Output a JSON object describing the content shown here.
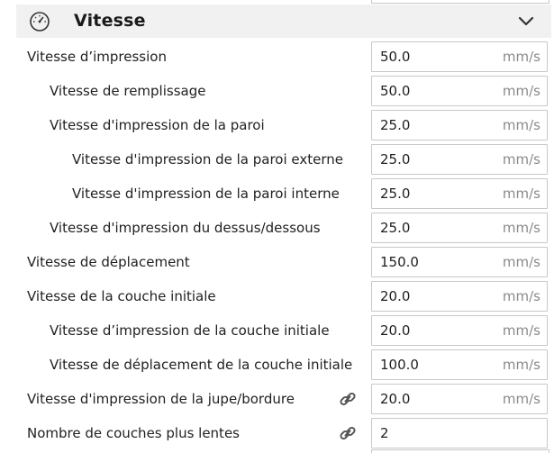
{
  "section": {
    "title": "Vitesse",
    "icon": "speedometer-icon",
    "toggle_icon": "chevron-down-icon"
  },
  "settings": [
    {
      "label": "Vitesse d’impression",
      "value": "50.0",
      "unit": "mm/s",
      "indent": 0,
      "linked": false
    },
    {
      "label": "Vitesse de remplissage",
      "value": "50.0",
      "unit": "mm/s",
      "indent": 1,
      "linked": false
    },
    {
      "label": "Vitesse d'impression de la paroi",
      "value": "25.0",
      "unit": "mm/s",
      "indent": 1,
      "linked": false
    },
    {
      "label": "Vitesse d'impression de la paroi externe",
      "value": "25.0",
      "unit": "mm/s",
      "indent": 2,
      "linked": false
    },
    {
      "label": "Vitesse d'impression de la paroi interne",
      "value": "25.0",
      "unit": "mm/s",
      "indent": 2,
      "linked": false
    },
    {
      "label": "Vitesse d'impression du dessus/dessous",
      "value": "25.0",
      "unit": "mm/s",
      "indent": 1,
      "linked": false
    },
    {
      "label": "Vitesse de déplacement",
      "value": "150.0",
      "unit": "mm/s",
      "indent": 0,
      "linked": false
    },
    {
      "label": "Vitesse de la couche initiale",
      "value": "20.0",
      "unit": "mm/s",
      "indent": 0,
      "linked": false
    },
    {
      "label": "Vitesse d’impression de la couche initiale",
      "value": "20.0",
      "unit": "mm/s",
      "indent": 1,
      "linked": false
    },
    {
      "label": "Vitesse de déplacement de la couche initiale",
      "value": "100.0",
      "unit": "mm/s",
      "indent": 1,
      "linked": false
    },
    {
      "label": "Vitesse d'impression de la jupe/bordure",
      "value": "20.0",
      "unit": "mm/s",
      "indent": 0,
      "linked": true
    },
    {
      "label": "Nombre de couches plus lentes",
      "value": "2",
      "unit": "",
      "indent": 0,
      "linked": true
    }
  ],
  "colors": {
    "header_bg": "#f1f1f1",
    "field_border": "#c8c8c8",
    "unit_text": "#8a8a8a"
  }
}
